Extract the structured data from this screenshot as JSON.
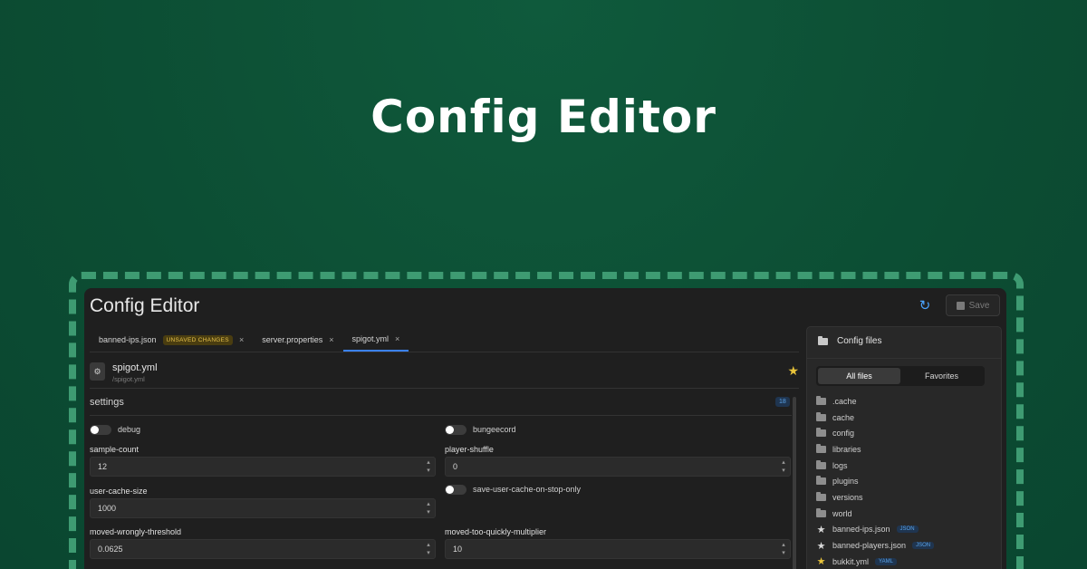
{
  "hero": {
    "title": "Config Editor"
  },
  "window": {
    "title": "Config Editor",
    "save_label": "Save"
  },
  "tabs": [
    {
      "label": "banned-ips.json",
      "badge": "UNSAVED CHANGES",
      "close": "×"
    },
    {
      "label": "server.properties",
      "close": "×"
    },
    {
      "label": "spigot.yml",
      "close": "×",
      "active": true
    }
  ],
  "file": {
    "name": "spigot.yml",
    "path": "/spigot.yml"
  },
  "section": {
    "title": "settings",
    "count": "18"
  },
  "options": {
    "debug": {
      "label": "debug",
      "on": false
    },
    "bungeecord": {
      "label": "bungeecord",
      "on": false
    },
    "save_user_cache": {
      "label": "save-user-cache-on-stop-only",
      "on": false
    }
  },
  "fields": {
    "sample_count": {
      "label": "sample-count",
      "value": "12"
    },
    "player_shuffle": {
      "label": "player-shuffle",
      "value": "0"
    },
    "user_cache_size": {
      "label": "user-cache-size",
      "value": "1000"
    },
    "moved_wrongly_threshold": {
      "label": "moved-wrongly-threshold",
      "value": "0.0625"
    },
    "moved_too_quickly_multiplier": {
      "label": "moved-too-quickly-multiplier",
      "value": "10"
    }
  },
  "sidebar": {
    "title": "Config files",
    "filters": [
      "All files",
      "Favorites"
    ],
    "folders": [
      ".cache",
      "cache",
      "config",
      "libraries",
      "logs",
      "plugins",
      "versions",
      "world"
    ],
    "files": [
      {
        "name": "banned-ips.json",
        "type": "JSON",
        "favorite": false
      },
      {
        "name": "banned-players.json",
        "type": "JSON",
        "favorite": false
      },
      {
        "name": "bukkit.yml",
        "type": "YAML",
        "favorite": true
      }
    ]
  },
  "colors": {
    "accent": "#3b82f6",
    "background": "#0c4d33",
    "warning": "#e7c24b",
    "star": "#e8c33a"
  }
}
